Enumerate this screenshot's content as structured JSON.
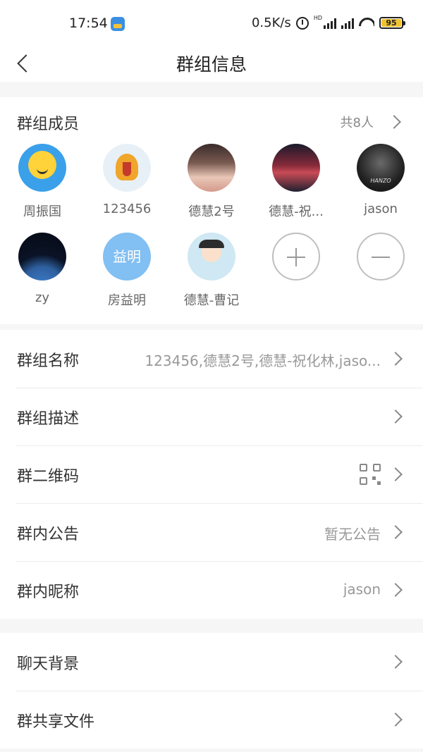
{
  "status_bar": {
    "time": "17:54",
    "network_speed": "0.5K/s",
    "hd_label": "HD",
    "battery": "95",
    "battery_color": "#f1c232"
  },
  "nav": {
    "title": "群组信息",
    "back_icon": "chevron-left-icon"
  },
  "members": {
    "section_title": "群组成员",
    "count_label": "共8人",
    "list": [
      {
        "name": "周振国",
        "avatar": "smiley-face"
      },
      {
        "name": "123456",
        "avatar": "bird-cartoon"
      },
      {
        "name": "德慧2号",
        "avatar": "girl-photo"
      },
      {
        "name": "德慧-祝...",
        "avatar": "red-screen-photo"
      },
      {
        "name": "jason",
        "avatar": "hanzo-dark",
        "avatar_text": "HANZO"
      },
      {
        "name": "zy",
        "avatar": "earth-photo"
      },
      {
        "name": "房益明",
        "avatar": "text-avatar",
        "avatar_text": "益明"
      },
      {
        "name": "德慧-曹记",
        "avatar": "boy-cartoon"
      }
    ],
    "add_button": "plus-icon",
    "remove_button": "minus-icon"
  },
  "settings": {
    "group_name": {
      "label": "群组名称",
      "value": "123456,德慧2号,德慧-祝化林,jaso..."
    },
    "group_desc": {
      "label": "群组描述",
      "value": ""
    },
    "group_qr": {
      "label": "群二维码",
      "icon": "qr-code-icon"
    },
    "announcement": {
      "label": "群内公告",
      "value": "暂无公告"
    },
    "nickname": {
      "label": "群内昵称",
      "value": "jason"
    },
    "chat_bg": {
      "label": "聊天背景"
    },
    "shared_files": {
      "label": "群共享文件"
    }
  },
  "colors": {
    "background": "#f6f6f6",
    "card": "#ffffff",
    "avatar_text_bg": "#82bff2"
  }
}
